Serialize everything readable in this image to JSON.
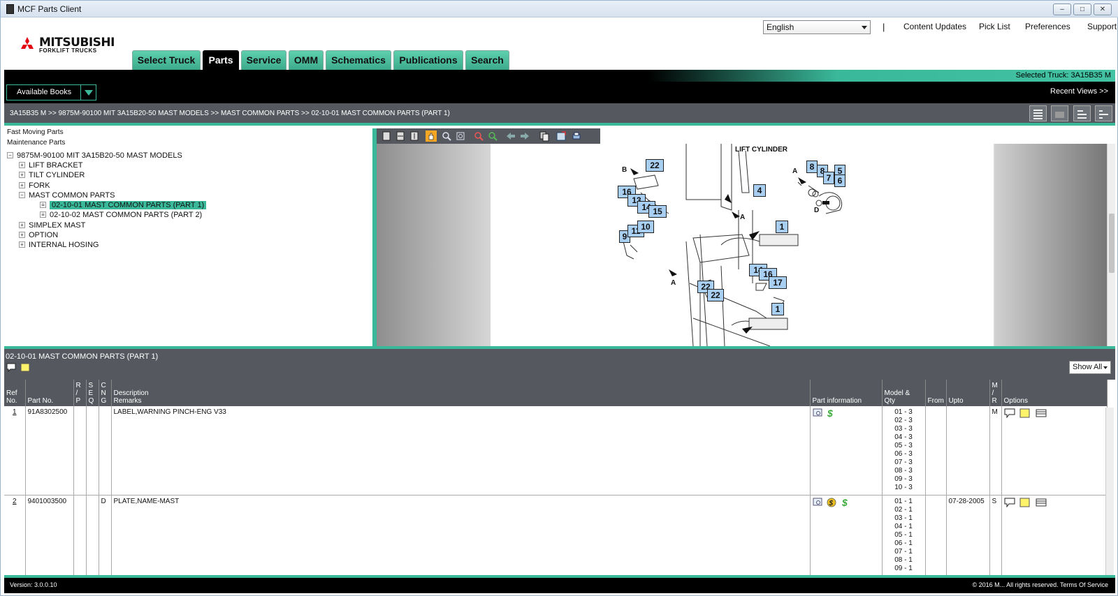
{
  "window": {
    "title": "MCF Parts Client"
  },
  "logo": {
    "brand": "MITSUBISHI",
    "sub": "FORKLIFT TRUCKS"
  },
  "header": {
    "language": "English",
    "separator": "|",
    "links": [
      "Content Updates",
      "Pick List",
      "Preferences",
      "Support"
    ]
  },
  "tabs": [
    "Select Truck",
    "Parts",
    "Service",
    "OMM",
    "Schematics",
    "Publications",
    "Search"
  ],
  "active_tab": "Parts",
  "selected_truck": "Selected Truck:  3A15B35 M",
  "available_books": "Available Books",
  "recent_views": "Recent Views >>",
  "breadcrumb": "3A15B35 M >> 9875M-90100 MIT 3A15B20-50 MAST MODELS >> MAST COMMON PARTS >> 02-10-01 MAST COMMON PARTS (PART 1)",
  "tree": {
    "fast_moving": "Fast Moving Parts",
    "maintenance": "Maintenance Parts",
    "root": "9875M-90100 MIT 3A15B20-50 MAST MODELS",
    "items": [
      "LIFT BRACKET",
      "TILT CYLINDER",
      "FORK",
      "MAST COMMON PARTS",
      "02-10-01 MAST COMMON PARTS (PART 1)",
      "02-10-02 MAST COMMON PARTS (PART 2)",
      "SIMPLEX MAST",
      "OPTION",
      "INTERNAL HOSING"
    ]
  },
  "diagram": {
    "title": "LIFT CYLINDER",
    "callouts": [
      "22",
      "16",
      "13",
      "14",
      "15",
      "9",
      "11",
      "10",
      "8",
      "8",
      "7",
      "5",
      "6",
      "4",
      "1",
      "14",
      "16",
      "17",
      "22",
      "22",
      "1"
    ],
    "letters": [
      "B",
      "A",
      "D",
      "A",
      "A"
    ]
  },
  "parts": {
    "title": "02-10-01 MAST COMMON PARTS (PART 1)",
    "show_all": "Show All",
    "headers": {
      "ref": "Ref No.",
      "part_no": "Part No.",
      "rp": "R / P",
      "seq": "S E Q",
      "cng": "C N G",
      "desc": "Description",
      "remarks": "Remarks",
      "part_info": "Part information",
      "model_qty": "Model & Qty",
      "from": "From",
      "upto": "Upto",
      "mr": "M / R",
      "options": "Options"
    },
    "rows": [
      {
        "ref": "1",
        "part_no": "91A8302500",
        "cng": "",
        "desc": "LABEL,WARNING PINCH-ENG V33",
        "upto": "",
        "mr": "M",
        "model_qty": [
          "01 - 3",
          "02 - 3",
          "03 - 3",
          "04 - 3",
          "05 - 3",
          "06 - 3",
          "07 - 3",
          "08 - 3",
          "09 - 3",
          "10 - 3"
        ]
      },
      {
        "ref": "2",
        "part_no": "9401003500",
        "cng": "D",
        "desc": "PLATE,NAME-MAST",
        "upto": "07-28-2005",
        "mr": "S",
        "model_qty": [
          "01 - 1",
          "02 - 1",
          "03 - 1",
          "04 - 1",
          "05 - 1",
          "06 - 1",
          "07 - 1",
          "08 - 1",
          "09 - 1"
        ]
      }
    ]
  },
  "footer": {
    "version": "Version: 3.0.0.10",
    "copyright": "© 2016 M... All rights reserved.  Terms Of Service"
  },
  "colors": {
    "accent": "#3ab99a",
    "dark": "#55595f",
    "callout": "#a8cff2"
  }
}
